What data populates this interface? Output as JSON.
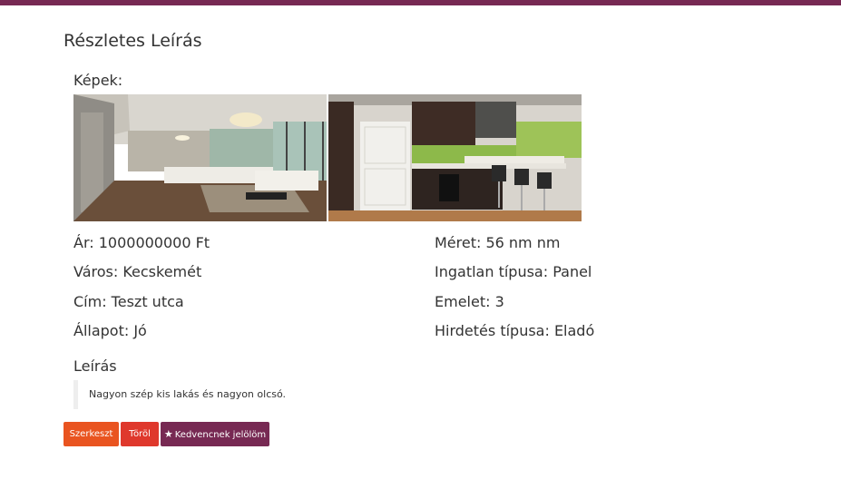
{
  "page": {
    "title": "Részletes Leírás",
    "images_label": "Képek:",
    "images": [
      {
        "name": "living-room-photo"
      },
      {
        "name": "kitchen-photo"
      }
    ]
  },
  "details": {
    "price": "Ár: 1000000000 Ft",
    "city": "Város: Kecskemét",
    "address": "Cím: Teszt utca",
    "condition": "Állapot: Jó",
    "size": "Méret: 56 nm nm",
    "property_type": "Ingatlan típusa: Panel",
    "floor": "Emelet: 3",
    "ad_type": "Hirdetés típusa: Eladó"
  },
  "description": {
    "heading": "Leírás",
    "text": "Nagyon szép kis lakás és nagyon olcsó."
  },
  "actions": {
    "edit": "Szerkeszt",
    "delete": "Töröl",
    "favorite": "Kedvencnek jelölöm",
    "favorite_icon": "star-icon"
  },
  "colors": {
    "topbar": "#772953",
    "edit": "#e95420",
    "delete": "#df382c",
    "favorite": "#772953"
  }
}
